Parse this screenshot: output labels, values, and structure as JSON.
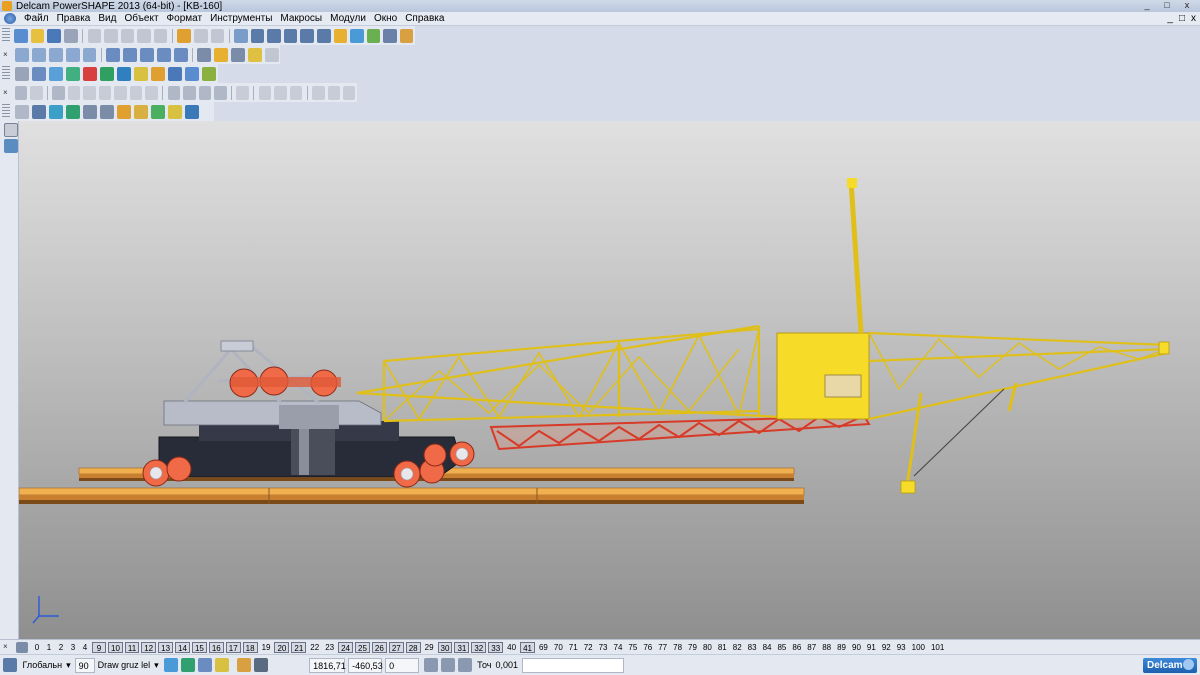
{
  "window": {
    "title": "Delcam PowerSHAPE 2013 (64-bit) - [KB-160]",
    "minimize": "_",
    "maximize": "□",
    "close": "x"
  },
  "menu": [
    "Файл",
    "Правка",
    "Вид",
    "Объект",
    "Формат",
    "Инструменты",
    "Макросы",
    "Модули",
    "Окно",
    "Справка"
  ],
  "mdi_buttons": [
    "_",
    "□",
    "x"
  ],
  "colors": {
    "crane_boom": "#f0d020",
    "wheels": "#f06040",
    "underframe": "#282c38",
    "rails": "#e8a040",
    "accent": "#1d5fae"
  },
  "levels": [
    "0",
    "1",
    "2",
    "3",
    "4",
    "9",
    "10",
    "11",
    "12",
    "13",
    "14",
    "15",
    "16",
    "17",
    "18",
    "19",
    "20",
    "21",
    "22",
    "23",
    "24",
    "25",
    "26",
    "27",
    "28",
    "29",
    "30",
    "31",
    "32",
    "33",
    "40",
    "41",
    "69",
    "70",
    "71",
    "72",
    "73",
    "74",
    "75",
    "76",
    "77",
    "78",
    "79",
    "80",
    "81",
    "82",
    "83",
    "84",
    "85",
    "86",
    "87",
    "88",
    "89",
    "90",
    "91",
    "92",
    "93",
    "100",
    "101"
  ],
  "boxed_levels": [
    "9",
    "10",
    "11",
    "12",
    "13",
    "14",
    "15",
    "16",
    "17",
    "18",
    "20",
    "21",
    "24",
    "25",
    "26",
    "27",
    "28",
    "30",
    "31",
    "32",
    "33",
    "41"
  ],
  "status": {
    "workplane": "Глобальн",
    "level_num": "90",
    "level_name": "Draw gruz lel",
    "x": "1816,71",
    "y": "-460,53",
    "z": "0",
    "tol_label": "Точ",
    "tol_value": "0,001",
    "brand": "Delcam"
  }
}
